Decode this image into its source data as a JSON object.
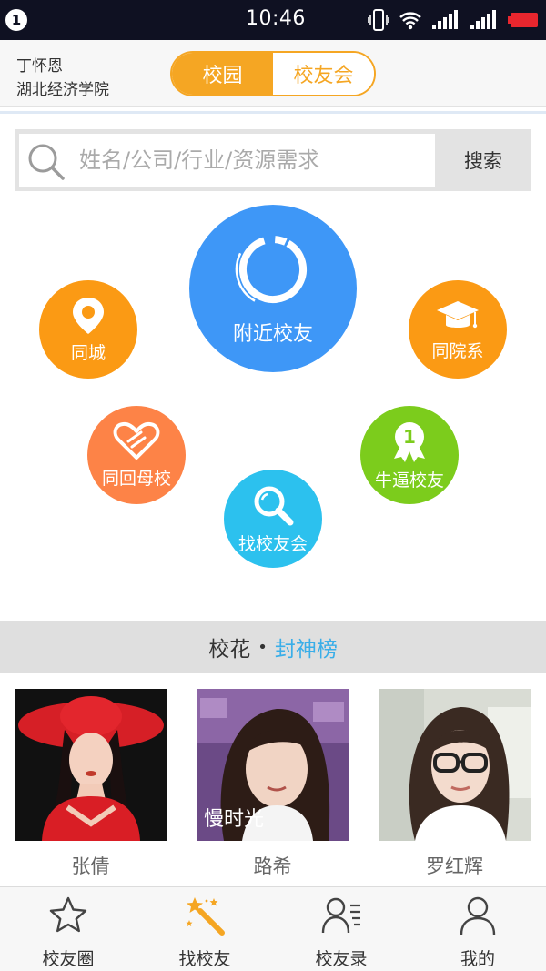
{
  "status_bar": {
    "notification_count": "1",
    "time": "10:46",
    "icons": [
      "vibrate-icon",
      "wifi-icon",
      "signal-1-icon",
      "signal-2-icon",
      "battery-low-icon"
    ]
  },
  "header": {
    "user_name": "丁怀恩",
    "school": "湖北经济学院",
    "segments": [
      {
        "label": "校园",
        "active": true
      },
      {
        "label": "校友会",
        "active": false
      }
    ]
  },
  "search": {
    "placeholder": "姓名/公司/行业/资源需求",
    "button_label": "搜索"
  },
  "features": {
    "nearby": "附近校友",
    "same_city": "同城",
    "same_department": "同院系",
    "same_alma_mater": "同回母校",
    "top_alumni": "牛逼校友",
    "find_association": "找校友会"
  },
  "banner": {
    "part1": "校花",
    "separator": "•",
    "part2": "封神榜"
  },
  "featured_people": [
    {
      "name": "张倩"
    },
    {
      "name": "路希"
    },
    {
      "name": "罗红辉"
    }
  ],
  "tabbar": [
    {
      "label": "校友圈",
      "icon": "star-icon"
    },
    {
      "label": "找校友",
      "icon": "magic-wand-icon"
    },
    {
      "label": "校友录",
      "icon": "contacts-icon"
    },
    {
      "label": "我的",
      "icon": "person-icon"
    }
  ],
  "colors": {
    "accent_orange": "#f5a623",
    "nearby_blue": "#3e97f7",
    "alma_orange": "#fd8347",
    "top_green": "#7ccc1c",
    "find_cyan": "#2cc1ee",
    "banner_blue": "#3aaee8"
  }
}
